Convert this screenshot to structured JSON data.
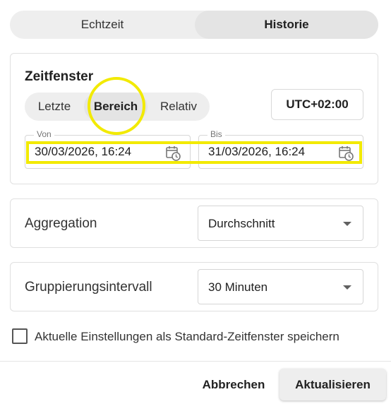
{
  "tabs": {
    "realtime": "Echtzeit",
    "history": "Historie",
    "active": "history"
  },
  "timewindow": {
    "title": "Zeitfenster",
    "modes": [
      "Letzte",
      "Bereich",
      "Relativ"
    ],
    "active_mode": "Bereich",
    "timezone": "UTC+02:00",
    "from": {
      "label": "Von",
      "value": "30/03/2026, 16:24",
      "icon": "calendar-clock-icon"
    },
    "to": {
      "label": "Bis",
      "value": "31/03/2026, 16:24",
      "icon": "calendar-clock-icon"
    }
  },
  "aggregation": {
    "label": "Aggregation",
    "value": "Durchschnitt"
  },
  "grouping": {
    "label": "Gruppierungsintervall",
    "value": "30 Minuten"
  },
  "save_default": {
    "label": "Aktuelle Einstellungen als Standard-Zeitfenster speichern",
    "checked": false
  },
  "footer": {
    "cancel": "Abbrechen",
    "update": "Aktualisieren"
  },
  "colors": {
    "highlight": "#f2ea00",
    "segment_bg": "#eeeeee"
  }
}
